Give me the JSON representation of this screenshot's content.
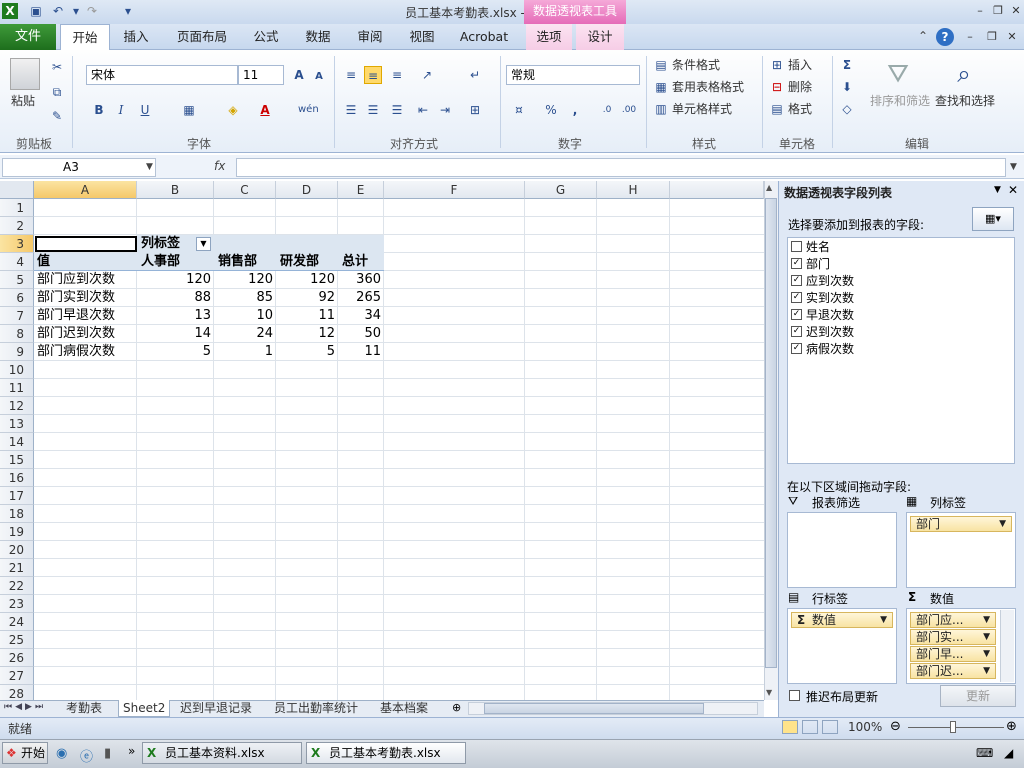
{
  "window": {
    "title": "员工基本考勤表.xlsx - Microsoft Excel",
    "context_tools_title": "数据透视表工具"
  },
  "tabs": {
    "file": "文件",
    "items": [
      "开始",
      "插入",
      "页面布局",
      "公式",
      "数据",
      "审阅",
      "视图",
      "Acrobat",
      "选项",
      "设计"
    ],
    "active": "开始"
  },
  "ribbon": {
    "clipboard": {
      "paste": "粘贴",
      "label": "剪贴板"
    },
    "font": {
      "name": "宋体",
      "size": "11",
      "bold": "B",
      "italic": "I",
      "underline": "U",
      "label": "字体"
    },
    "alignment": {
      "label": "对齐方式"
    },
    "number": {
      "format": "常规",
      "percent": "%",
      "comma": ",",
      "label": "数字"
    },
    "styles": {
      "conditional": "条件格式",
      "table": "套用表格格式",
      "cell": "单元格样式",
      "label": "样式"
    },
    "cells": {
      "insert": "插入",
      "delete": "删除",
      "format": "格式",
      "label": "单元格"
    },
    "editing": {
      "sum": "Σ",
      "sort": "排序和筛选",
      "find": "查找和选择",
      "label": "编辑"
    }
  },
  "formula_bar": {
    "name_box": "A3",
    "fx": "fx",
    "value": ""
  },
  "columns": [
    "A",
    "B",
    "C",
    "D",
    "E",
    "F",
    "G",
    "H",
    "I"
  ],
  "rows": [
    "1",
    "2",
    "3",
    "4",
    "5",
    "6",
    "7",
    "8",
    "9",
    "10",
    "11",
    "12",
    "13",
    "14",
    "15",
    "16",
    "17",
    "18",
    "19",
    "20",
    "21",
    "22",
    "23",
    "24",
    "25",
    "26",
    "27",
    "28"
  ],
  "pivot": {
    "col_label": "列标签",
    "row_header": "值",
    "headers": [
      "人事部",
      "销售部",
      "研发部",
      "总计"
    ],
    "data": [
      {
        "label": "部门应到次数",
        "values": [
          "120",
          "120",
          "120",
          "360"
        ]
      },
      {
        "label": "部门实到次数",
        "values": [
          "88",
          "85",
          "92",
          "265"
        ]
      },
      {
        "label": "部门早退次数",
        "values": [
          "13",
          "10",
          "11",
          "34"
        ]
      },
      {
        "label": "部门迟到次数",
        "values": [
          "14",
          "24",
          "12",
          "50"
        ]
      },
      {
        "label": "部门病假次数",
        "values": [
          "5",
          "1",
          "5",
          "11"
        ]
      }
    ]
  },
  "sheets": {
    "tabs": [
      "考勤表",
      "Sheet2",
      "迟到早退记录",
      "员工出勤率统计",
      "基本档案"
    ],
    "active": "Sheet2"
  },
  "status": {
    "ready": "就绪",
    "zoom": "100%"
  },
  "field_pane": {
    "title": "数据透视表字段列表",
    "choose_label": "选择要添加到报表的字段:",
    "fields": [
      {
        "name": "姓名",
        "checked": false
      },
      {
        "name": "部门",
        "checked": true
      },
      {
        "name": "应到次数",
        "checked": true
      },
      {
        "name": "实到次数",
        "checked": true
      },
      {
        "name": "早退次数",
        "checked": true
      },
      {
        "name": "迟到次数",
        "checked": true
      },
      {
        "name": "病假次数",
        "checked": true
      }
    ],
    "drag_label": "在以下区域间拖动字段:",
    "report_filter": "报表筛选",
    "column_labels": "列标签",
    "row_labels": "行标签",
    "values": "数值",
    "column_chip": "部门",
    "row_chip": "数值",
    "value_chips": [
      "部门应...",
      "部门实...",
      "部门早...",
      "部门迟..."
    ],
    "defer": "推迟布局更新",
    "update": "更新"
  },
  "taskbar": {
    "start": "开始",
    "items": [
      "员工基本资料.xlsx",
      "员工基本考勤表.xlsx"
    ]
  }
}
